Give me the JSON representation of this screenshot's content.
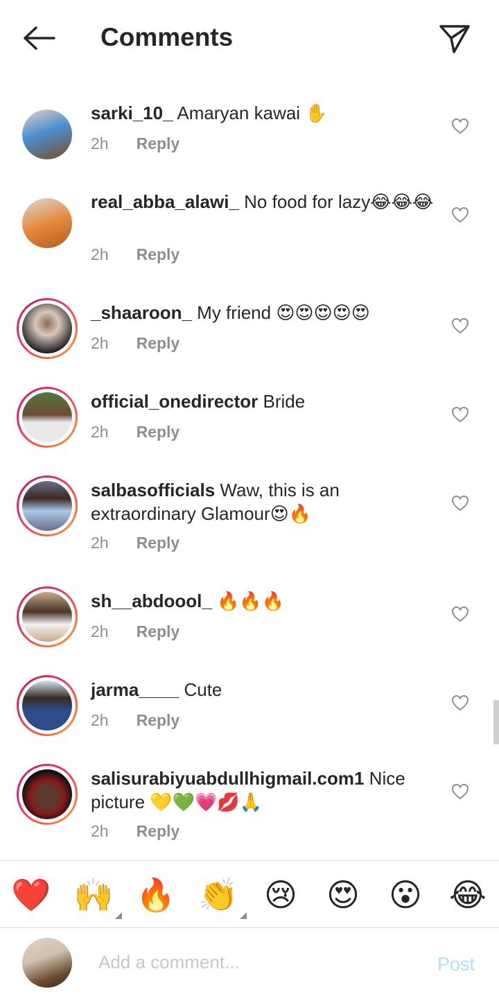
{
  "header": {
    "title": "Comments",
    "back_icon": "arrow-left-icon",
    "send_icon": "paper-plane-icon"
  },
  "comments": [
    {
      "username": "sarki_10_",
      "text": " Amaryan kawai ✋",
      "time": "2h",
      "reply": "Reply",
      "story_ring": false,
      "avatar_colors": [
        "#4a8fd0",
        "#7b4a2b",
        "#e7d3c4"
      ]
    },
    {
      "username": "real_abba_alawi_",
      "text": " No food for lazy😂😂😂",
      "time": "2h",
      "reply": "Reply",
      "story_ring": false,
      "avatar_colors": [
        "#e58b3e",
        "#b55a1f",
        "#d9d9d9"
      ]
    },
    {
      "username": "_shaaroon_",
      "text": " My friend 😍😍😍😍😍",
      "time": "2h",
      "reply": "Reply",
      "story_ring": true,
      "avatar_colors": [
        "#1e1e1e",
        "#8a6a5a",
        "#d8c7bd"
      ]
    },
    {
      "username": "official_onedirector",
      "text": " Bride",
      "time": "2h",
      "reply": "Reply",
      "story_ring": true,
      "avatar_colors": [
        "#4f7a3a",
        "#e8e8e8",
        "#6d4a36"
      ]
    },
    {
      "username": "salbasofficials",
      "text": " Waw, this is an extraordinary Glamour😍🔥",
      "time": "2h",
      "reply": "Reply",
      "story_ring": true,
      "avatar_colors": [
        "#6c6c8c",
        "#a9c7e6",
        "#3b2a22"
      ]
    },
    {
      "username": "sh__abdoool_",
      "text": " 🔥🔥🔥",
      "time": "2h",
      "reply": "Reply",
      "story_ring": true,
      "avatar_colors": [
        "#c9a98b",
        "#f2f2f2",
        "#4a3526"
      ]
    },
    {
      "username": "jarma____",
      "text": " Cute",
      "time": "2h",
      "reply": "Reply",
      "story_ring": true,
      "avatar_colors": [
        "#cfe3f2",
        "#2c4c8c",
        "#3b2a22"
      ]
    },
    {
      "username": "salisurabiyuabdullhigmail.com1",
      "text": " Nice picture 💛💚💗💋🙏",
      "time": "2h",
      "reply": "Reply",
      "story_ring": true,
      "avatar_colors": [
        "#111111",
        "#8b1a1a",
        "#5a3a2a"
      ]
    }
  ],
  "like_icon": "heart-outline-icon",
  "reactions": [
    {
      "emoji": "❤️",
      "name": "red-heart",
      "has_more": false
    },
    {
      "emoji": "🙌",
      "name": "raising-hands",
      "has_more": true
    },
    {
      "emoji": "🔥",
      "name": "fire",
      "has_more": false
    },
    {
      "emoji": "👏",
      "name": "clapping-hands",
      "has_more": true
    },
    {
      "emoji": "😢",
      "name": "crying-face",
      "has_more": false
    },
    {
      "emoji": "😍",
      "name": "heart-eyes",
      "has_more": false
    },
    {
      "emoji": "😮",
      "name": "surprised-face",
      "has_more": false
    },
    {
      "emoji": "😂",
      "name": "tears-of-joy",
      "has_more": false
    }
  ],
  "composer": {
    "placeholder": "Add a comment...",
    "post_label": "Post"
  },
  "colors": {
    "text": "#262626",
    "muted": "#8e8e8e",
    "post_disabled": "#b2dffc",
    "divider": "#dbdbdb"
  }
}
